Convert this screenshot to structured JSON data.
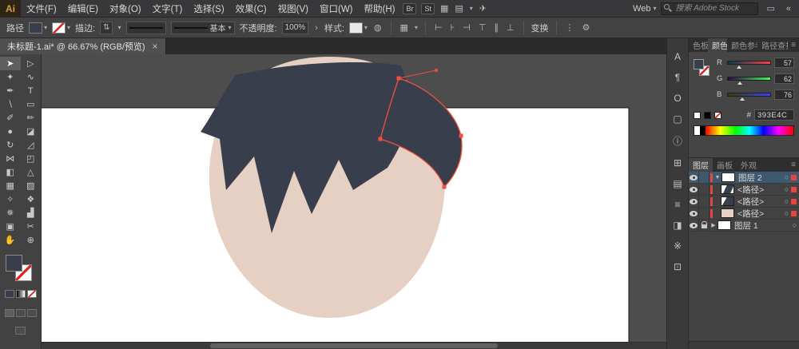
{
  "colors": {
    "hair": "#393E4C",
    "skin": "#E5D0C3",
    "selection": "#F2503F",
    "layer_color": "#E8453C"
  },
  "icons": {
    "chevron_down": "▾",
    "triangle_down": "▼",
    "triangle_right": "▶",
    "circle_target": "○",
    "menu": "≡",
    "double_left": "«",
    "window": "▭",
    "stepper": "⇅",
    "globe": "◍",
    "gear": "⚙",
    "dots": "⋮",
    "grid": "▦",
    "layout": "▤",
    "rocket": "✈",
    "more": "›"
  },
  "menubar": {
    "logo": "Ai",
    "items": [
      "文件(F)",
      "编辑(E)",
      "对象(O)",
      "文字(T)",
      "选择(S)",
      "效果(C)",
      "视图(V)",
      "窗口(W)",
      "帮助(H)"
    ],
    "bridge_label": "Br",
    "stock_label": "St",
    "workspace_label": "Web",
    "search_placeholder": "搜索 Adobe Stock"
  },
  "controlbar": {
    "context_label": "路径",
    "stroke_label": "描边:",
    "brush_name": "基本",
    "opacity_label": "不透明度:",
    "opacity_value": "100%",
    "style_label": "样式:",
    "transform_label": "变换",
    "align_icons": [
      {
        "name": "align-left",
        "glyph": "⊢"
      },
      {
        "name": "align-center-h",
        "glyph": "⊦"
      },
      {
        "name": "align-right",
        "glyph": "⊣"
      },
      {
        "name": "align-top",
        "glyph": "⊤"
      },
      {
        "name": "align-middle-v",
        "glyph": "∥"
      },
      {
        "name": "align-bottom",
        "glyph": "⊥"
      }
    ]
  },
  "tabbar": {
    "doc_title": "未标题-1.ai* @ 66.67% (RGB/预览)",
    "close": "×"
  },
  "toolbox": {
    "tools": [
      {
        "name": "selection",
        "glyph": "➤"
      },
      {
        "name": "direct-selection",
        "glyph": "▷"
      },
      {
        "name": "magic-wand",
        "glyph": "✦"
      },
      {
        "name": "lasso",
        "glyph": "∿"
      },
      {
        "name": "pen",
        "glyph": "✒"
      },
      {
        "name": "type",
        "glyph": "T"
      },
      {
        "name": "line-segment",
        "glyph": "∖"
      },
      {
        "name": "rectangle",
        "glyph": "▭"
      },
      {
        "name": "paintbrush",
        "glyph": "✐"
      },
      {
        "name": "pencil",
        "glyph": "✏"
      },
      {
        "name": "blob-brush",
        "glyph": "●"
      },
      {
        "name": "eraser",
        "glyph": "◪"
      },
      {
        "name": "rotate",
        "glyph": "↻"
      },
      {
        "name": "scale",
        "glyph": "◿"
      },
      {
        "name": "width",
        "glyph": "⋈"
      },
      {
        "name": "free-transform",
        "glyph": "◰"
      },
      {
        "name": "shape-builder",
        "glyph": "◧"
      },
      {
        "name": "perspective-grid",
        "glyph": "△"
      },
      {
        "name": "mesh",
        "glyph": "▦"
      },
      {
        "name": "gradient",
        "glyph": "▨"
      },
      {
        "name": "eyedropper",
        "glyph": "✧"
      },
      {
        "name": "blend",
        "glyph": "❖"
      },
      {
        "name": "symbol-sprayer",
        "glyph": "✵"
      },
      {
        "name": "column-graph",
        "glyph": "▟"
      },
      {
        "name": "artboard",
        "glyph": "▣"
      },
      {
        "name": "slice",
        "glyph": "✂"
      },
      {
        "name": "hand",
        "glyph": "✋"
      },
      {
        "name": "zoom",
        "glyph": "⊕"
      }
    ]
  },
  "dock": {
    "icons": [
      {
        "name": "character-panel",
        "glyph": "A"
      },
      {
        "name": "paragraph-panel",
        "glyph": "¶"
      },
      {
        "name": "opentype-panel",
        "glyph": "O"
      },
      {
        "name": "artboards-panel",
        "glyph": "▢"
      },
      {
        "name": "info-panel",
        "glyph": "ⓘ"
      },
      {
        "name": "transform-panel",
        "glyph": "⊞"
      },
      {
        "name": "gradient-panel",
        "glyph": "▤"
      },
      {
        "name": "stroke-panel",
        "glyph": "≡"
      },
      {
        "name": "transparency-panel",
        "glyph": "◨"
      },
      {
        "name": "align-panel",
        "glyph": "※"
      },
      {
        "name": "links-panel",
        "glyph": "⊡"
      }
    ]
  },
  "color_panel": {
    "tabs": [
      "色板",
      "颜色",
      "颜色参考",
      "路径查找"
    ],
    "channels": [
      {
        "label": "R",
        "value": "57"
      },
      {
        "label": "G",
        "value": "62"
      },
      {
        "label": "B",
        "value": "76"
      }
    ],
    "hex_prefix": "#",
    "hex_value": "393E4C"
  },
  "layers_panel": {
    "tabs": [
      "图层",
      "画板",
      "外观"
    ],
    "rows": [
      {
        "name": "图层 2"
      },
      {
        "name": "<路径>"
      },
      {
        "name": "<路径>"
      },
      {
        "name": "<路径>"
      },
      {
        "name": "图层 1"
      }
    ]
  }
}
